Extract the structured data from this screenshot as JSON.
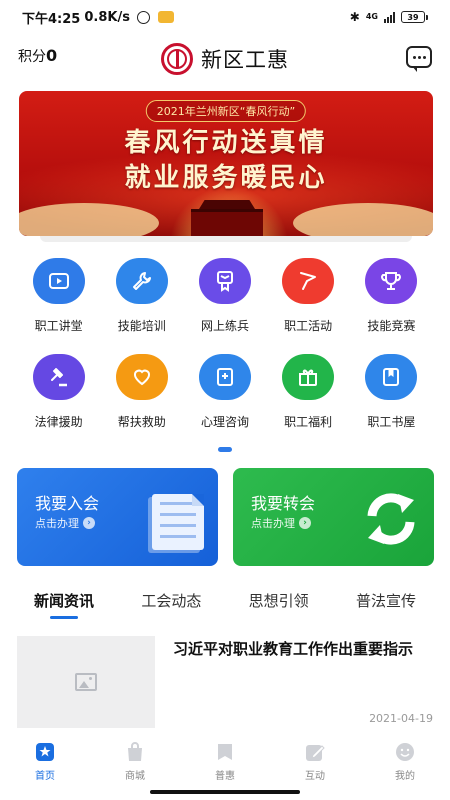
{
  "status_bar": {
    "time": "下午4:25",
    "speed": "0.8K/s",
    "network": "4G",
    "battery": "39"
  },
  "header": {
    "points_label": "积分",
    "points_value": "0",
    "title": "新区工惠",
    "logo_icon": "union-logo-icon",
    "message_icon": "chat-bubble-icon"
  },
  "banner": {
    "tag": "2021年兰州新区“春风行动”",
    "line1": "春风行动送真情",
    "line2": "就业服务暖民心"
  },
  "features": [
    {
      "label": "职工讲堂",
      "icon": "video-play-icon",
      "color": "#2f7be8"
    },
    {
      "label": "技能培训",
      "icon": "wrench-icon",
      "color": "#2f86ea"
    },
    {
      "label": "网上练兵",
      "icon": "medal-icon",
      "color": "#6a4ce8"
    },
    {
      "label": "职工活动",
      "icon": "flag-icon",
      "color": "#ef3b2f"
    },
    {
      "label": "技能竞赛",
      "icon": "trophy-icon",
      "color": "#7a45e6"
    },
    {
      "label": "法律援助",
      "icon": "gavel-icon",
      "color": "#6548e3"
    },
    {
      "label": "帮扶救助",
      "icon": "heart-hand-icon",
      "color": "#f59a12"
    },
    {
      "label": "心理咨询",
      "icon": "medical-book-icon",
      "color": "#2f86ea"
    },
    {
      "label": "职工福利",
      "icon": "gift-icon",
      "color": "#22b54a"
    },
    {
      "label": "职工书屋",
      "icon": "book-icon",
      "color": "#2f86ea"
    }
  ],
  "cards": {
    "join": {
      "title": "我要入会",
      "subtitle": "点击办理",
      "color": "#1f6fe6"
    },
    "transfer": {
      "title": "我要转会",
      "subtitle": "点击办理",
      "color": "#22b347"
    }
  },
  "tabs": [
    "新闻资讯",
    "工会动态",
    "思想引领",
    "普法宣传"
  ],
  "news": [
    {
      "title": "习近平对职业教育工作作出重要指示",
      "date": "2021-04-19"
    }
  ],
  "bottom_nav": [
    {
      "label": "首页",
      "icon": "home-icon",
      "active": true
    },
    {
      "label": "商城",
      "icon": "shopping-bag-icon",
      "active": false
    },
    {
      "label": "普惠",
      "icon": "bookmark-icon",
      "active": false
    },
    {
      "label": "互动",
      "icon": "pen-icon",
      "active": false
    },
    {
      "label": "我的",
      "icon": "smiley-icon",
      "active": false
    }
  ],
  "colors": {
    "accent": "#1a6ee0",
    "brand_red": "#c8102e"
  }
}
